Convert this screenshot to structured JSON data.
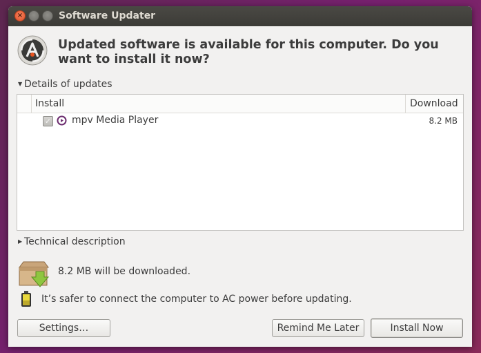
{
  "window": {
    "title": "Software Updater",
    "controls": {
      "close": "×",
      "minimize": "–",
      "maximize": "□"
    }
  },
  "header": {
    "headline": "Updated software is available for this computer. Do you want to install it now?",
    "icon": "software-updater-icon"
  },
  "details": {
    "label": "Details of updates",
    "expanded": true,
    "columns": {
      "install": "Install",
      "download": "Download"
    },
    "rows": [
      {
        "checked": true,
        "name": "mpv Media Player",
        "size": "8.2 MB",
        "icon": "mpv-icon"
      }
    ]
  },
  "technical": {
    "label": "Technical description",
    "expanded": false
  },
  "info": {
    "download_text": "8.2 MB will be downloaded.",
    "power_text": "It’s safer to connect the computer to AC power before updating."
  },
  "buttons": {
    "settings": "Settings…",
    "remind": "Remind Me Later",
    "install": "Install Now"
  },
  "colors": {
    "desktop": "#77216f",
    "titlebar": "#3c3b37",
    "window_bg": "#f2f1f0",
    "close_button": "#e0502b",
    "mpv_icon": "#6b2c6e"
  }
}
